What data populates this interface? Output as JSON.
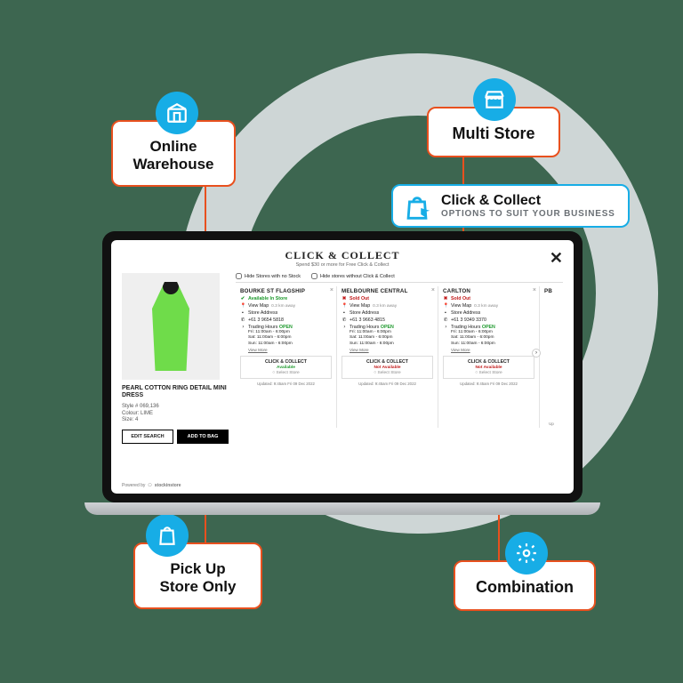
{
  "features": {
    "online_warehouse": "Online\nWarehouse",
    "multi_store": "Multi Store",
    "pickup": "Pick Up\nStore Only",
    "combination": "Combination"
  },
  "callout": {
    "title": "Click & Collect",
    "subtitle": "OPTIONS TO SUIT YOUR BUSINESS"
  },
  "modal": {
    "title": "CLICK & COLLECT",
    "subtitle": "Spend $30 or more for Free Click & Collect",
    "filters": {
      "no_stock": "Hide Stores with no Stock",
      "no_cc": "Hide stores without Click & Collect"
    },
    "product": {
      "name": "PEARL COTTON RING DETAIL MINI DRESS",
      "style_label": "Style # 069,136",
      "colour_label": "Colour: LIME",
      "size_label": "Size: 4",
      "edit": "EDIT SEARCH",
      "add": "ADD TO BAG"
    },
    "powered": "Powered by",
    "brand": "stockinstore",
    "updated": "Updated: 9:45am Fri 09 Dec 2022",
    "hours_label": "Trading Hours",
    "open": "OPEN",
    "view_map": "View Map",
    "distance": "0.3 km away",
    "store_address": "Store Address",
    "view_more": "View More",
    "cc_heading": "CLICK & COLLECT",
    "available": "Available",
    "not_available": "Not Available",
    "select_store": "Select Store",
    "hours": {
      "fri": "Fri:   11:00am - 6:00pm",
      "sat": "Sat:  11:00am - 6:00pm",
      "sun": "Sun: 11:00am - 6:00pm"
    },
    "stores": [
      {
        "name": "BOURKE ST FLAGSHIP",
        "status": "Available In Store",
        "status_kind": "green",
        "phone": "+61 3 9654 5818",
        "cc_status": "Available",
        "cc_kind": "green",
        "selectable": true
      },
      {
        "name": "MELBOURNE CENTRAL",
        "status": "Sold Out",
        "status_kind": "red",
        "phone": "+61 3 9663 4815",
        "cc_status": "Not Available",
        "cc_kind": "red",
        "selectable": false
      },
      {
        "name": "CARLTON",
        "status": "Sold Out",
        "status_kind": "red",
        "phone": "+61 3 9349 3370",
        "cc_status": "Not Available",
        "cc_kind": "red",
        "selectable": false
      }
    ],
    "peek_store": "PB"
  }
}
